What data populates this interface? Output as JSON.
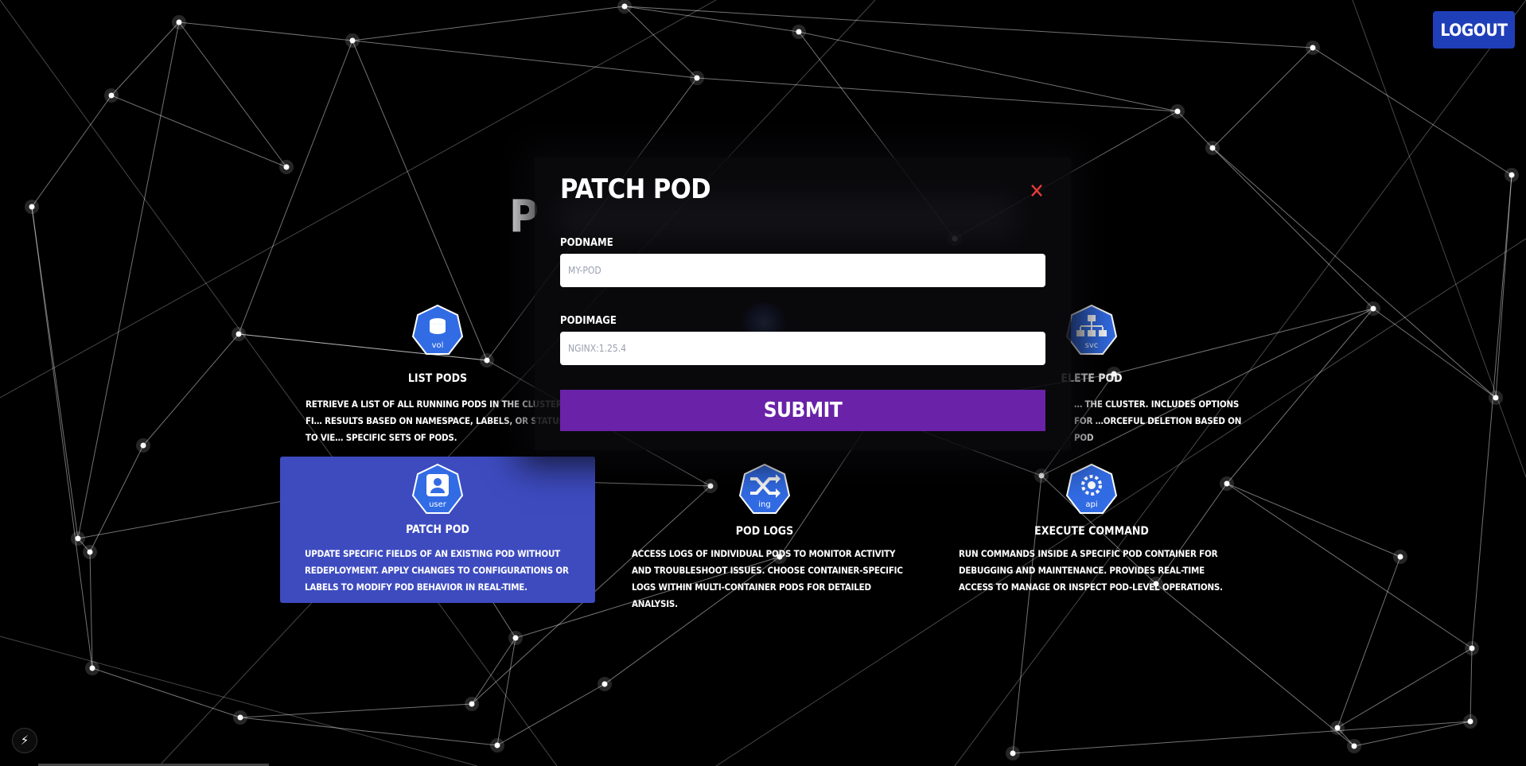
{
  "header": {
    "logout_label": "LOGOUT",
    "page_title_visible": "P"
  },
  "cards": [
    {
      "title": "LIST PODS",
      "icon_label": "vol",
      "icon": "database-icon",
      "description": "RETRIEVE A LIST OF ALL RUNNING PODS IN THE CLUSTER. FI… RESULTS BASED ON NAMESPACE, LABELS, OR STATUS TO VIE… SPECIFIC SETS OF PODS."
    },
    {
      "title": "ELETE POD",
      "icon_label": "svc",
      "icon": "sitemap-icon",
      "description": "… THE CLUSTER. INCLUDES OPTIONS FOR …ORCEFUL DELETION BASED ON POD"
    },
    {
      "title": "PATCH POD",
      "icon_label": "user",
      "icon": "user-badge-icon",
      "description": "UPDATE SPECIFIC FIELDS OF AN EXISTING POD WITHOUT REDEPLOYMENT. APPLY CHANGES TO CONFIGURATIONS OR LABELS TO MODIFY POD BEHAVIOR IN REAL-TIME."
    },
    {
      "title": "POD LOGS",
      "icon_label": "ing",
      "icon": "shuffle-icon",
      "description": "ACCESS LOGS OF INDIVIDUAL PODS TO MONITOR ACTIVITY AND TROUBLESHOOT ISSUES. CHOOSE CONTAINER-SPECIFIC LOGS WITHIN MULTI-CONTAINER PODS FOR DETAILED ANALYSIS."
    },
    {
      "title": "EXECUTE COMMAND",
      "icon_label": "api",
      "icon": "gears-icon",
      "description": "RUN COMMANDS INSIDE A SPECIFIC POD CONTAINER FOR DEBUGGING AND MAINTENANCE. PROVIDES REAL-TIME ACCESS TO MANAGE OR INSPECT POD-LEVEL OPERATIONS."
    }
  ],
  "modal": {
    "title": "PATCH POD",
    "close_icon": "close-icon",
    "fields": [
      {
        "label": "PODNAME",
        "placeholder": "MY-POD",
        "value": ""
      },
      {
        "label": "PODIMAGE",
        "placeholder": "NGINX:1.25.4",
        "value": ""
      }
    ],
    "submit_label": "SUBMIT"
  },
  "colors": {
    "accent_blue": "#1f3fb8",
    "card_active": "#3d4bbf",
    "hex_blue": "#326ce5",
    "submit_purple": "#6a22a8",
    "close_red": "#e53a3a"
  },
  "footer": {
    "bolt_icon": "lightning-icon"
  }
}
